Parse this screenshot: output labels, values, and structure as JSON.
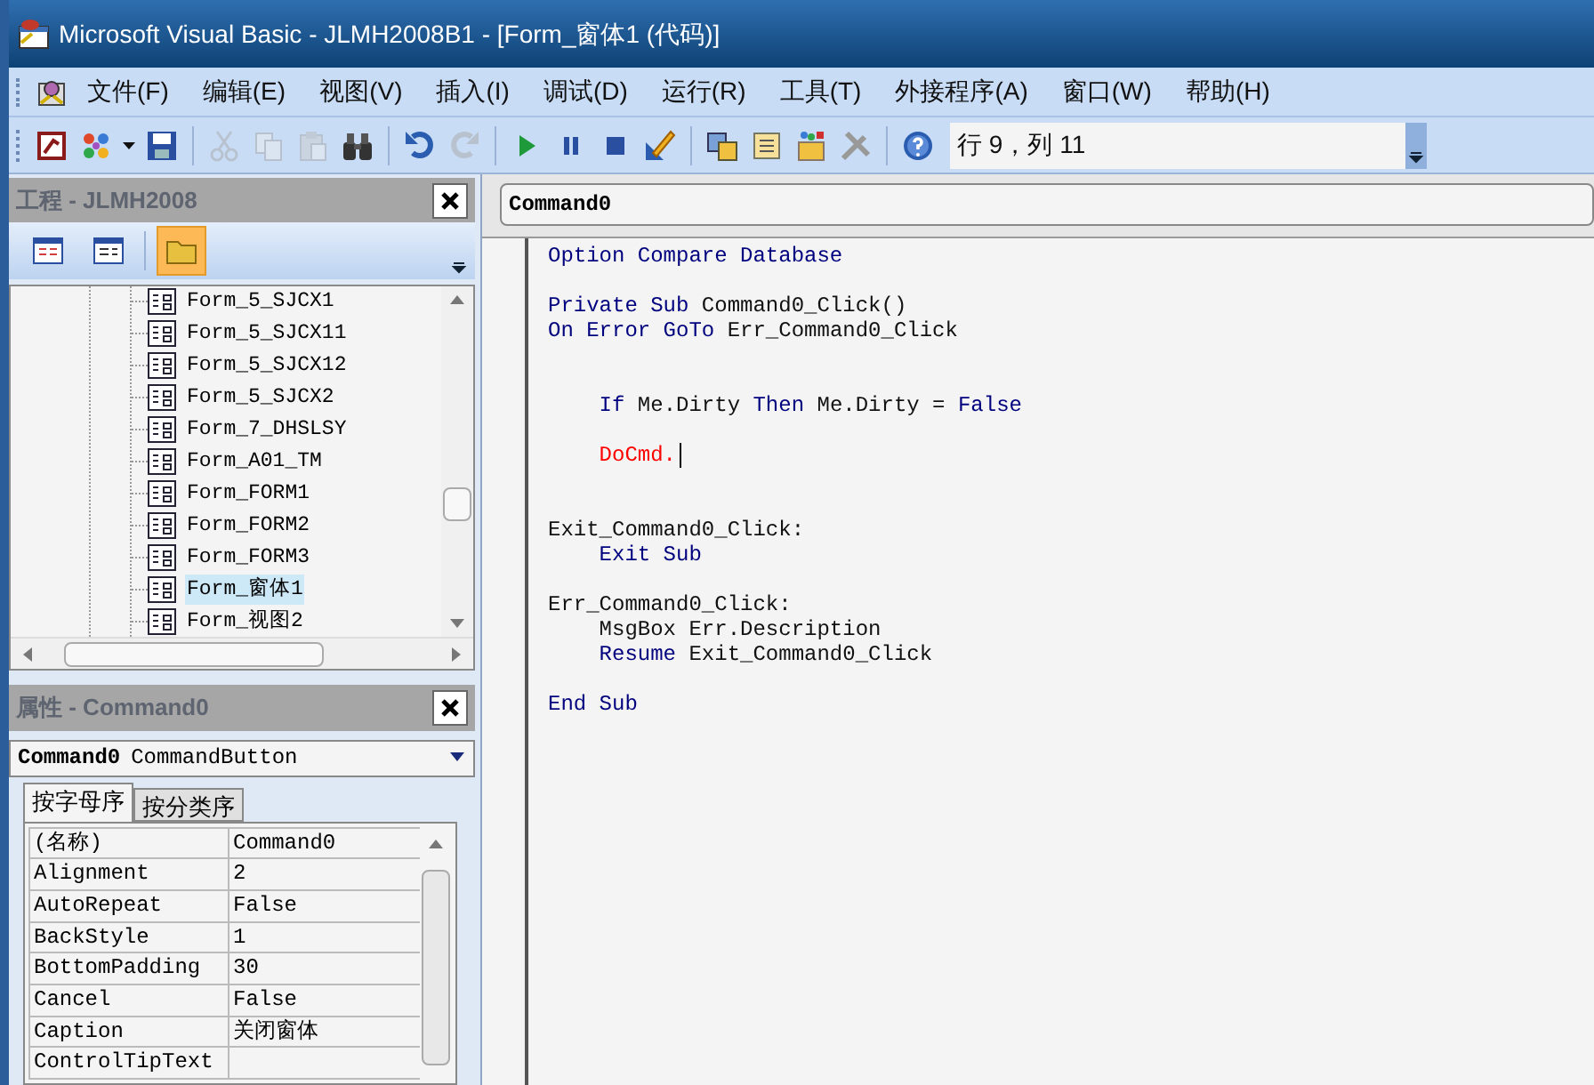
{
  "window": {
    "title": "Microsoft Visual Basic - JLMH2008B1 - [Form_窗体1 (代码)]"
  },
  "menu": [
    "文件(F)",
    "编辑(E)",
    "视图(V)",
    "插入(I)",
    "调试(D)",
    "运行(R)",
    "工具(T)",
    "外接程序(A)",
    "窗口(W)",
    "帮助(H)"
  ],
  "toolbar": {
    "items": [
      {
        "kind": "button",
        "disabled": false
      },
      {
        "kind": "button",
        "disabled": false
      },
      {
        "kind": "button",
        "disabled": false
      },
      {
        "kind": "separator"
      },
      {
        "kind": "button",
        "disabled": true
      },
      {
        "kind": "button",
        "disabled": true
      },
      {
        "kind": "button",
        "disabled": true
      },
      {
        "kind": "button",
        "disabled": false
      },
      {
        "kind": "separator"
      },
      {
        "kind": "button",
        "disabled": false
      },
      {
        "kind": "button",
        "disabled": true
      },
      {
        "kind": "separator"
      },
      {
        "kind": "button",
        "disabled": false
      },
      {
        "kind": "button",
        "disabled": false
      },
      {
        "kind": "button",
        "disabled": false
      },
      {
        "kind": "button",
        "disabled": false
      },
      {
        "kind": "separator"
      },
      {
        "kind": "button",
        "disabled": false
      },
      {
        "kind": "button",
        "disabled": false
      },
      {
        "kind": "button",
        "disabled": false
      },
      {
        "kind": "button",
        "disabled": false
      },
      {
        "kind": "separator"
      },
      {
        "kind": "button",
        "disabled": false
      }
    ],
    "position": "行 9，列 11"
  },
  "project": {
    "title": "工程 - JLMH2008",
    "buttons": [
      {
        "selected": false
      },
      {
        "selected": false
      },
      {
        "selected": true
      }
    ],
    "items": [
      {
        "label": "Form_5_SJCX1",
        "selected": false
      },
      {
        "label": "Form_5_SJCX11",
        "selected": false
      },
      {
        "label": "Form_5_SJCX12",
        "selected": false
      },
      {
        "label": "Form_5_SJCX2",
        "selected": false
      },
      {
        "label": "Form_7_DHSLSY",
        "selected": false
      },
      {
        "label": "Form_A01_TM",
        "selected": false
      },
      {
        "label": "Form_FORM1",
        "selected": false
      },
      {
        "label": "Form_FORM2",
        "selected": false
      },
      {
        "label": "Form_FORM3",
        "selected": false
      },
      {
        "label": "Form_窗体1",
        "selected": true
      },
      {
        "label": "Form_视图2",
        "selected": false
      }
    ]
  },
  "properties": {
    "title": "属性 - Command0",
    "object_name": "Command0",
    "object_type": "CommandButton",
    "tabs": [
      {
        "label": "按字母序",
        "selected": true
      },
      {
        "label": "按分类序",
        "selected": false
      }
    ],
    "rows": [
      {
        "name": "(名称)",
        "value": "Command0"
      },
      {
        "name": "Alignment",
        "value": "2"
      },
      {
        "name": "AutoRepeat",
        "value": "False"
      },
      {
        "name": "BackStyle",
        "value": "1"
      },
      {
        "name": "BottomPadding",
        "value": "30"
      },
      {
        "name": "Cancel",
        "value": "False"
      },
      {
        "name": "Caption",
        "value": "关闭窗体"
      },
      {
        "name": "ControlTipText"
      }
    ]
  },
  "code": {
    "object": "Command0",
    "lines": [
      {
        "kind": "code",
        "caret": false,
        "tokens": [
          {
            "kind": "keyword",
            "text": "Option Compare Database"
          }
        ]
      },
      {
        "kind": "blank"
      },
      {
        "kind": "code",
        "caret": false,
        "tokens": [
          {
            "kind": "keyword",
            "text": "Private Sub"
          },
          {
            "kind": "plain",
            "text": "Command0_Click()"
          }
        ]
      },
      {
        "kind": "code",
        "caret": false,
        "tokens": [
          {
            "kind": "keyword",
            "text": "On Error GoTo"
          },
          {
            "kind": "plain",
            "text": "Err_Command0_Click"
          }
        ]
      },
      {
        "kind": "blank"
      },
      {
        "kind": "blank"
      },
      {
        "kind": "code",
        "caret": false,
        "tokens": [
          {
            "kind": "keyword",
            "text": "    If"
          },
          {
            "kind": "plain",
            "text": "Me.Dirty"
          },
          {
            "kind": "keyword",
            "text": "Then"
          },
          {
            "kind": "plain",
            "text": "Me.Dirty ="
          },
          {
            "kind": "keyword",
            "text": "False"
          }
        ]
      },
      {
        "kind": "blank"
      },
      {
        "kind": "code",
        "caret": true,
        "tokens": [
          {
            "kind": "error",
            "text": "    DoCmd."
          }
        ]
      },
      {
        "kind": "blank"
      },
      {
        "kind": "blank"
      },
      {
        "kind": "code",
        "caret": false,
        "tokens": [
          {
            "kind": "plain",
            "text": "Exit_Command0_Click:"
          }
        ]
      },
      {
        "kind": "code",
        "caret": false,
        "tokens": [
          {
            "kind": "keyword",
            "text": "    Exit Sub"
          }
        ]
      },
      {
        "kind": "blank"
      },
      {
        "kind": "code",
        "caret": false,
        "tokens": [
          {
            "kind": "plain",
            "text": "Err_Command0_Click:"
          }
        ]
      },
      {
        "kind": "code",
        "caret": false,
        "tokens": [
          {
            "kind": "plain",
            "text": "    MsgBox Err.Description"
          }
        ]
      },
      {
        "kind": "code",
        "caret": false,
        "tokens": [
          {
            "kind": "keyword",
            "text": "    Resume"
          },
          {
            "kind": "plain",
            "text": "Exit_Command0_Click"
          }
        ]
      },
      {
        "kind": "blank"
      },
      {
        "kind": "code",
        "caret": false,
        "tokens": [
          {
            "kind": "keyword",
            "text": "End Sub"
          }
        ]
      }
    ]
  }
}
